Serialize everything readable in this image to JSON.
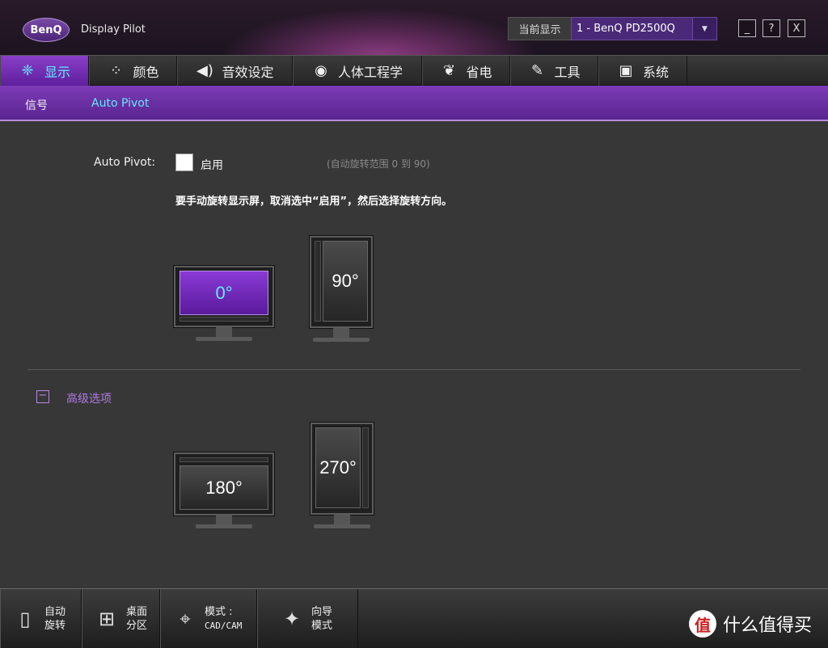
{
  "app": {
    "logo": "BenQ",
    "name": "Display Pilot",
    "current_display_label": "当前显示",
    "current_display_value": "1 - BenQ PD2500Q",
    "window_buttons": [
      "_",
      "?",
      "X"
    ]
  },
  "tabs": [
    {
      "label": "显示",
      "icon": "display-icon",
      "glyph": "❈",
      "active": true
    },
    {
      "label": "颜色",
      "icon": "color-icon",
      "glyph": "⁘",
      "active": false
    },
    {
      "label": "音效设定",
      "icon": "speaker-icon",
      "glyph": "◀)",
      "active": false
    },
    {
      "label": "人体工程学",
      "icon": "eye-icon",
      "glyph": "◉",
      "active": false
    },
    {
      "label": "省电",
      "icon": "leaf-icon",
      "glyph": "❦",
      "active": false
    },
    {
      "label": "工具",
      "icon": "wrench-icon",
      "glyph": "✎",
      "active": false
    },
    {
      "label": "系统",
      "icon": "system-icon",
      "glyph": "▣",
      "active": false
    }
  ],
  "subtabs": [
    {
      "label": "信号",
      "active": false
    },
    {
      "label": "Auto Pivot",
      "active": true
    }
  ],
  "auto_pivot": {
    "label": "Auto Pivot:",
    "enable_label": "启用",
    "enabled": false,
    "range_note": "(自动旋转范围 0 到 90)",
    "instruction": "要手动旋转显示屏，取消选中“启用”，然后选择旋转方向。"
  },
  "rotations": [
    {
      "label": "0°",
      "active": true
    },
    {
      "label": "90°",
      "active": false
    },
    {
      "label": "180°",
      "active": false
    },
    {
      "label": "270°",
      "active": false
    }
  ],
  "advanced": {
    "toggle": "−",
    "label": "高级选项"
  },
  "bottom_buttons": [
    {
      "line1": "自动",
      "line2": "旋转",
      "icon": "portrait-monitor-icon",
      "glyph": "▯"
    },
    {
      "line1": "桌面",
      "line2": "分区",
      "icon": "desktop-partition-icon",
      "glyph": "⊞"
    },
    {
      "line1": "模式 :",
      "line2": "CAD/CAM",
      "icon": "cad-cam-icon",
      "glyph": "⌖"
    },
    {
      "line1": "向导",
      "line2": "模式",
      "icon": "wizard-wand-icon",
      "glyph": "✦"
    }
  ],
  "watermark": {
    "badge": "值",
    "text": "什么值得买"
  }
}
